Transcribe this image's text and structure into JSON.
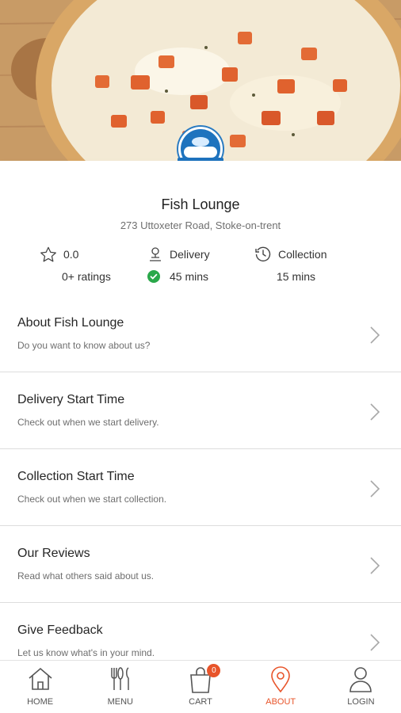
{
  "restaurant": {
    "name": "Fish Lounge",
    "address": "273 Uttoxeter Road, Stoke-on-trent"
  },
  "stats": {
    "rating_value": "0.0",
    "rating_count": "0+ ratings",
    "delivery_label": "Delivery",
    "delivery_time": "45 mins",
    "collection_label": "Collection",
    "collection_time": "15 mins"
  },
  "menu_items": [
    {
      "title": "About Fish Lounge",
      "subtitle": "Do you want to know about us?"
    },
    {
      "title": "Delivery Start Time",
      "subtitle": "Check out when we start delivery."
    },
    {
      "title": "Collection Start Time",
      "subtitle": "Check out when we start collection."
    },
    {
      "title": "Our Reviews",
      "subtitle": "Read what others said about us."
    },
    {
      "title": "Give Feedback",
      "subtitle": "Let us know what's in your mind."
    }
  ],
  "nav": {
    "home": "HOME",
    "menu": "MENU",
    "cart": "CART",
    "cart_count": "0",
    "about": "ABOUT",
    "login": "LOGIN"
  },
  "colors": {
    "accent": "#e8542a",
    "success": "#2aa84a",
    "logo_blue": "#1e73be"
  }
}
